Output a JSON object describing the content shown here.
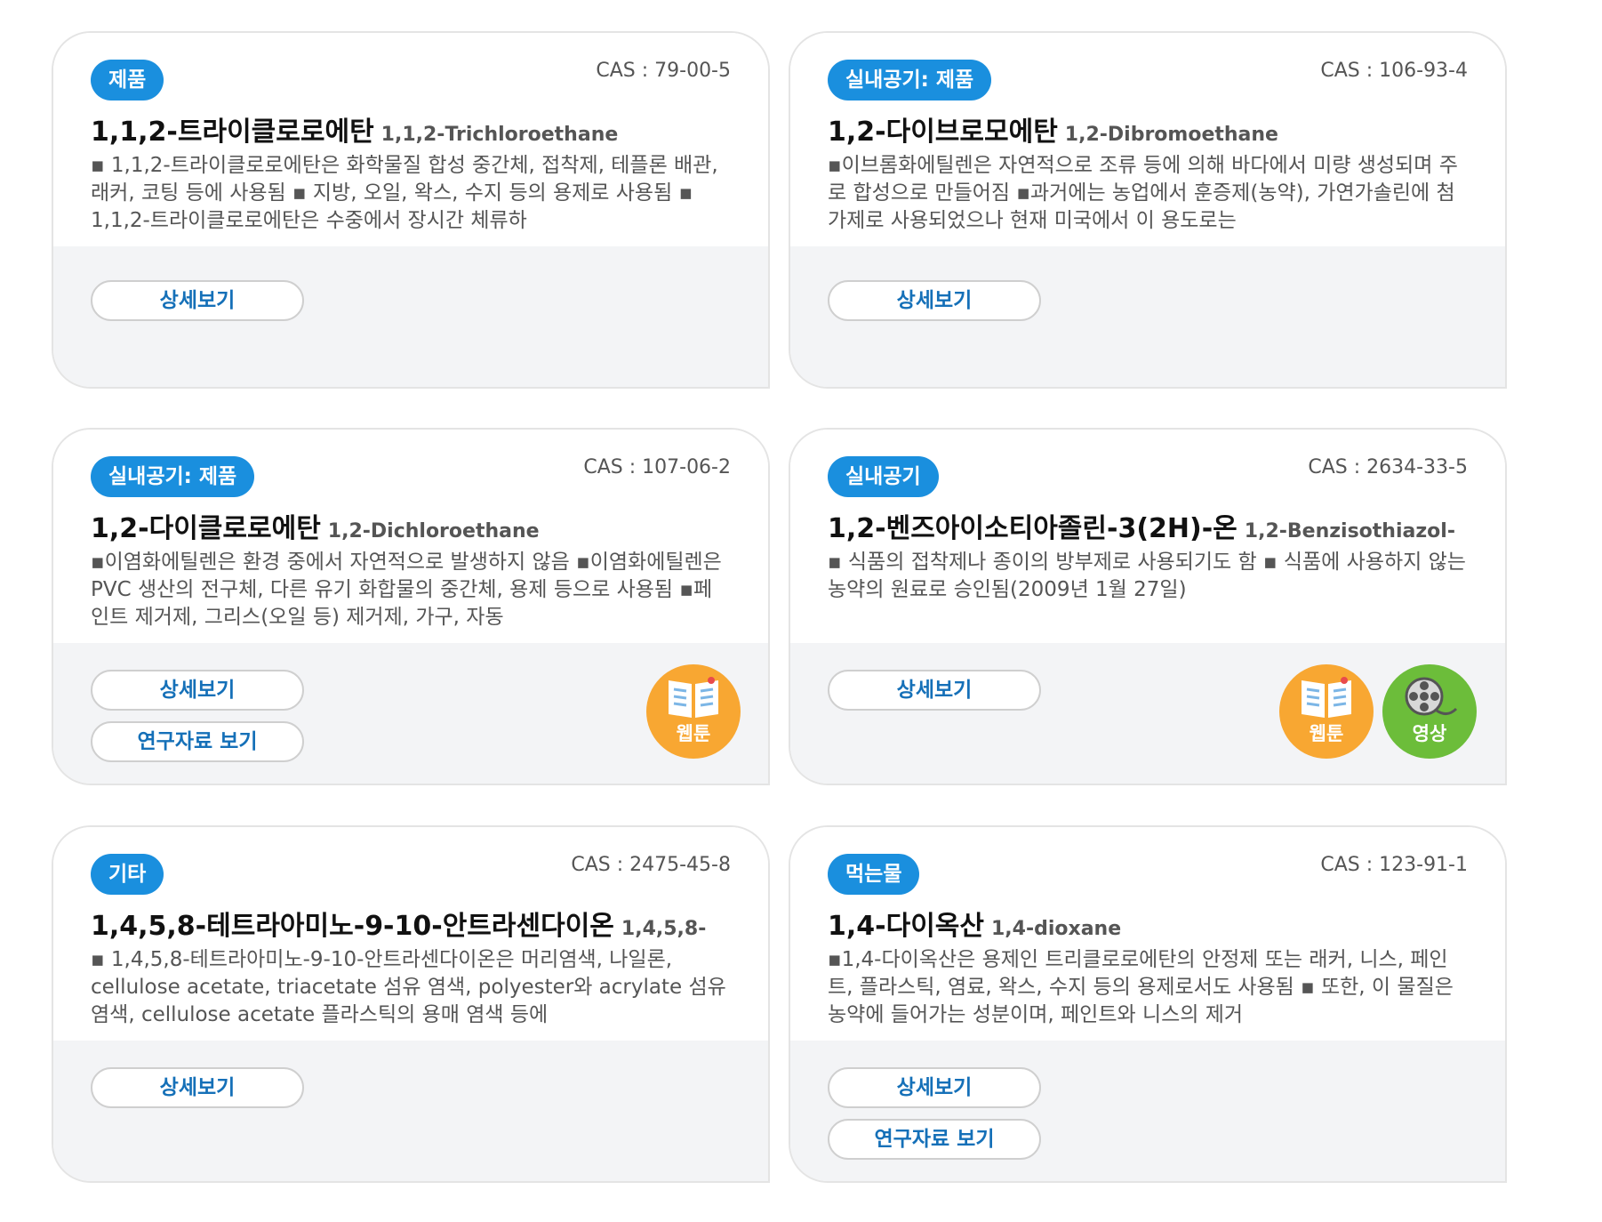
{
  "cards": [
    {
      "tag": "제품",
      "cas": "CAS : 79-00-5",
      "title_ko": "1,1,2-트라이클로로에탄",
      "title_en": "1,1,2-Trichloroethane",
      "description": "▪ 1,1,2-트라이클로로에탄은 화학물질 합성 중간체, 접착제, 테플론 배관, 래커, 코팅 등에 사용됨 ▪ 지방, 오일, 왁스, 수지 등의 용제로 사용됨 ▪ 1,1,2-트라이클로로에탄은 수중에서 장시간 체류하",
      "detail_button": "상세보기"
    },
    {
      "tag": "실내공기: 제품",
      "cas": "CAS : 106-93-4",
      "title_ko": "1,2-다이브로모에탄",
      "title_en": "1,2-Dibromoethane",
      "description": "▪이브롬화에틸렌은 자연적으로 조류 등에 의해 바다에서 미량 생성되며 주로 합성으로 만들어짐 ▪과거에는 농업에서 훈증제(농약), 가연가솔린에 첨가제로 사용되었으나 현재 미국에서 이 용도로는",
      "detail_button": "상세보기"
    },
    {
      "tag": "실내공기: 제품",
      "cas": "CAS : 107-06-2",
      "title_ko": "1,2-다이클로로에탄",
      "title_en": "1,2-Dichloroethane",
      "description": "▪이염화에틸렌은 환경 중에서 자연적으로 발생하지 않음 ▪이염화에틸렌은 PVC 생산의 전구체, 다른 유기 화합물의 중간체, 용제 등으로 사용됨 ▪페인트 제거제, 그리스(오일 등) 제거제, 가구, 자동",
      "detail_button": "상세보기",
      "research_button": "연구자료 보기",
      "webtoon_label": "웹툰"
    },
    {
      "tag": "실내공기",
      "cas": "CAS : 2634-33-5",
      "title_ko": "1,2-벤즈아이소티아졸린-3(2H)-온",
      "title_en": "1,2-Benzisothiazol-",
      "description": "▪ 식품의 접착제나 종이의 방부제로 사용되기도 함 ▪ 식품에 사용하지 않는 농약의 원료로 승인됨(2009년 1월 27일)",
      "detail_button": "상세보기",
      "webtoon_label": "웹툰",
      "video_label": "영상"
    },
    {
      "tag": "기타",
      "cas": "CAS : 2475-45-8",
      "title_ko": "1,4,5,8-테트라아미노-9-10-안트라센다이온",
      "title_en": "1,4,5,8-",
      "description": "▪ 1,4,5,8-테트라아미노-9-10-안트라센다이온은 머리염색, 나일론, cellulose acetate, triacetate 섬유 염색, polyester와 acrylate 섬유 염색, cellulose acetate 플라스틱의 용매 염색 등에",
      "detail_button": "상세보기"
    },
    {
      "tag": "먹는물",
      "cas": "CAS : 123-91-1",
      "title_ko": "1,4-다이옥산",
      "title_en": "1,4-dioxane",
      "description": "▪1,4-다이옥산은 용제인 트리클로로에탄의 안정제 또는 래커, 니스, 페인트, 플라스틱, 염료, 왁스, 수지 등의 용제로서도 사용됨 ▪ 또한, 이 물질은 농약에 들어가는 성분이며, 페인트와 니스의 제거",
      "detail_button": "상세보기",
      "research_button": "연구자료 보기"
    }
  ],
  "colors": {
    "tag_bg": "#1a8fde",
    "button_text": "#1570b8",
    "webtoon_icon": "#f8a732",
    "video_icon": "#6cbd3a",
    "card_footer_bg": "#f3f4f6"
  },
  "icons": [
    "book-icon",
    "film-reel-icon"
  ]
}
